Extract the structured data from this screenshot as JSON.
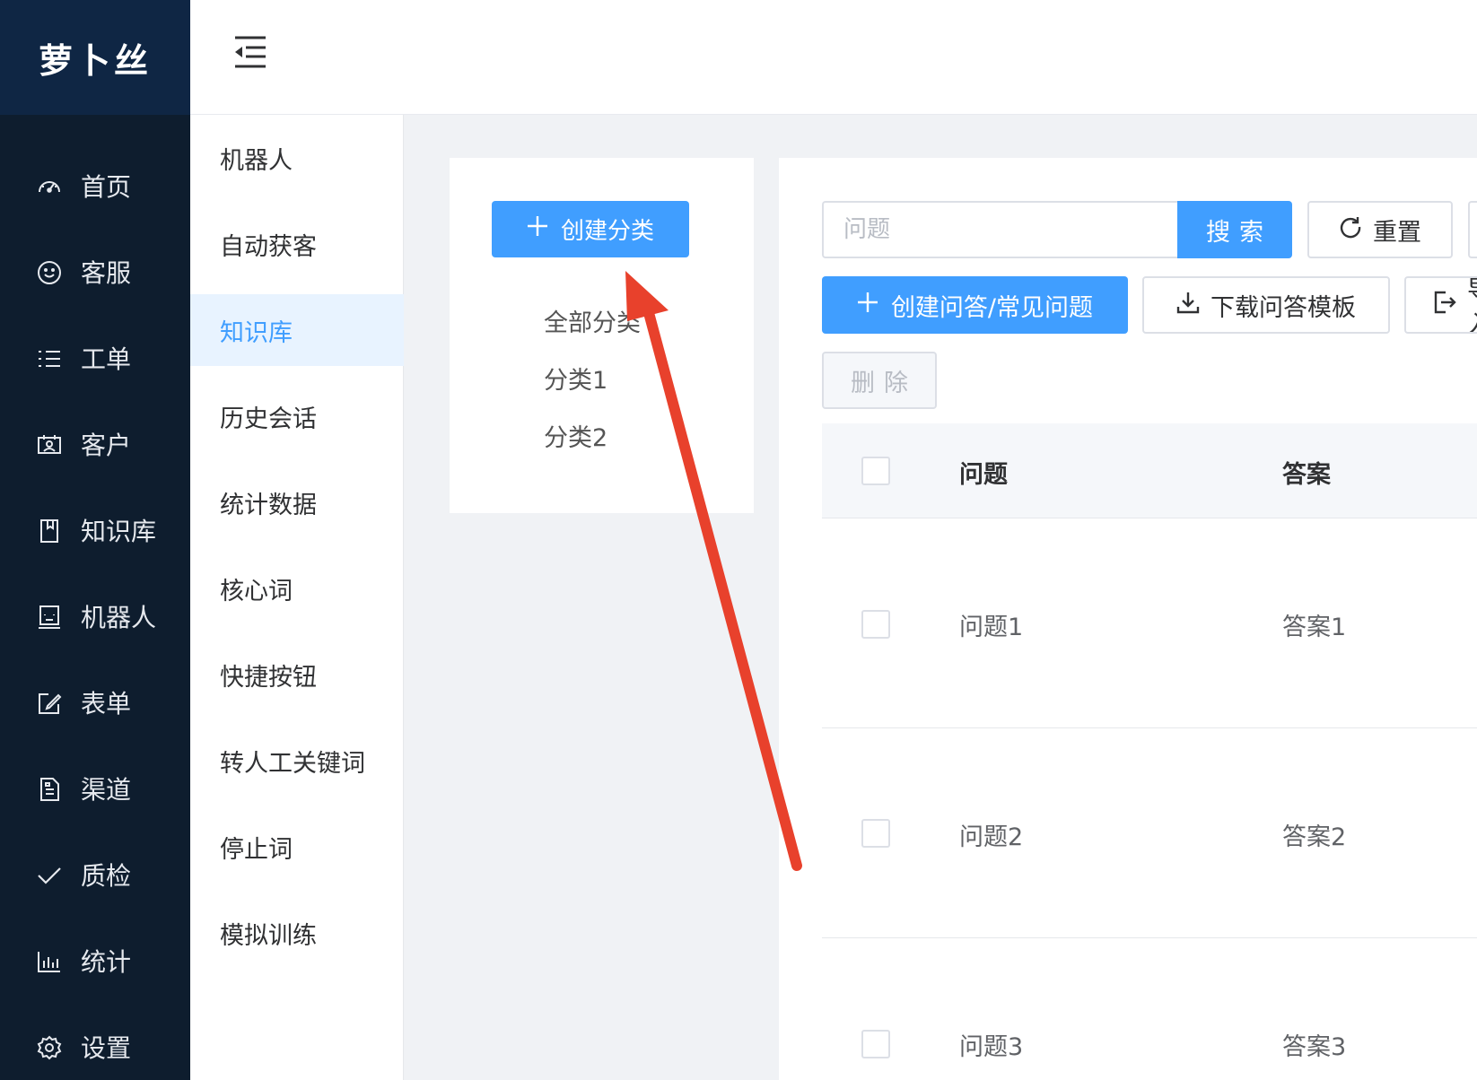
{
  "app": {
    "logo_text": "萝卜丝"
  },
  "sidebar": {
    "items": [
      {
        "label": "首页",
        "icon": "dashboard-icon"
      },
      {
        "label": "客服",
        "icon": "smile-icon"
      },
      {
        "label": "工单",
        "icon": "list-icon"
      },
      {
        "label": "客户",
        "icon": "contact-card-icon"
      },
      {
        "label": "知识库",
        "icon": "book-icon"
      },
      {
        "label": "机器人",
        "icon": "robot-icon"
      },
      {
        "label": "表单",
        "icon": "edit-form-icon"
      },
      {
        "label": "渠道",
        "icon": "document-icon"
      },
      {
        "label": "质检",
        "icon": "check-icon"
      },
      {
        "label": "统计",
        "icon": "bar-chart-icon"
      },
      {
        "label": "设置",
        "icon": "gear-icon"
      }
    ]
  },
  "subnav": {
    "active": "知识库",
    "items": [
      "机器人",
      "自动获客",
      "知识库",
      "历史会话",
      "统计数据",
      "核心词",
      "快捷按钮",
      "转人工关键词",
      "停止词",
      "模拟训练"
    ]
  },
  "categories": {
    "create_label": "创建分类",
    "items": [
      "全部分类",
      "分类1",
      "分类2"
    ]
  },
  "toolbar": {
    "search_placeholder": "问题",
    "search_label": "搜索",
    "reset_label": "重置",
    "create_qa_label": "创建问答/常见问题",
    "download_template_label": "下载问答模板",
    "import_label": "导入",
    "delete_label": "删除"
  },
  "table": {
    "columns": [
      "问题",
      "答案"
    ],
    "rows": [
      {
        "question": "问题1",
        "answer": "答案1"
      },
      {
        "question": "问题2",
        "answer": "答案2"
      },
      {
        "question": "问题3",
        "answer": "答案3"
      }
    ]
  },
  "colors": {
    "primary": "#409eff",
    "sidebar_bg": "#0e1d2e",
    "annotation_arrow": "#e8412c"
  }
}
